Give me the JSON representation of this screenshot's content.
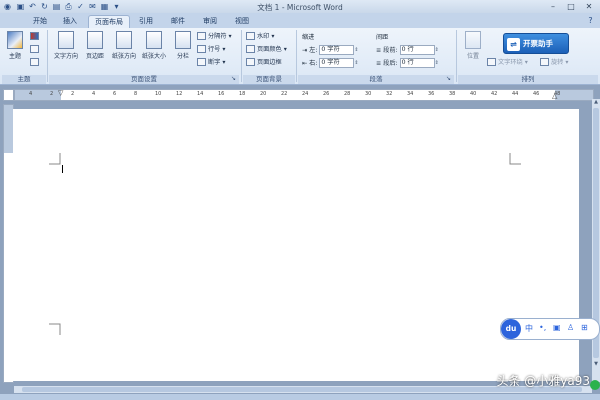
{
  "window": {
    "title": "文档 1 - Microsoft Word"
  },
  "tabs": [
    {
      "label": "开始"
    },
    {
      "label": "插入"
    },
    {
      "label": "页面布局"
    },
    {
      "label": "引用"
    },
    {
      "label": "邮件"
    },
    {
      "label": "审阅"
    },
    {
      "label": "视图"
    }
  ],
  "ribbon": {
    "theme_group": {
      "label": "主题",
      "theme_button": "主题"
    },
    "page_setup": {
      "label": "页面设置",
      "text_direction": "文字方向",
      "margins": "页边距",
      "orientation": "纸张方向",
      "size": "纸张大小",
      "columns": "分栏",
      "breaks": "分隔符",
      "line_numbers": "行号",
      "hyphenation": "断字"
    },
    "page_background": {
      "label": "页面背景",
      "watermark": "水印",
      "page_color": "页面颜色",
      "page_borders": "页面边框"
    },
    "paragraph": {
      "label": "段落",
      "indent_header": "缩进",
      "spacing_header": "间距",
      "indent_left_label": "左:",
      "indent_left_value": "0 字符",
      "indent_right_label": "右:",
      "indent_right_value": "0 字符",
      "spacing_before_label": "段前:",
      "spacing_before_value": "0 行",
      "spacing_after_label": "段后:",
      "spacing_after_value": "0 行"
    },
    "arrange": {
      "label": "排列",
      "position": "位置",
      "text_wrap": "文字环绕",
      "rotate": "旋转"
    },
    "helper_badge": "开票助手"
  },
  "ruler": {
    "ticks": [
      "4",
      "2",
      "2",
      "4",
      "6",
      "8",
      "10",
      "12",
      "14",
      "16",
      "18",
      "20",
      "22",
      "24",
      "26",
      "28",
      "30",
      "32",
      "34",
      "36",
      "38",
      "40",
      "42",
      "44",
      "46",
      "48"
    ]
  },
  "ime": {
    "brand": "du",
    "mode": "中"
  },
  "watermark": {
    "text": "头条 @小雅ya93"
  },
  "colors": {
    "ribbon_bg": "#dbe7f5",
    "tab_bar": "#c3d4ea",
    "workspace": "#8ea2bd",
    "ime_brand": "#2c64dc",
    "helper_badge": "#1c60b8"
  }
}
